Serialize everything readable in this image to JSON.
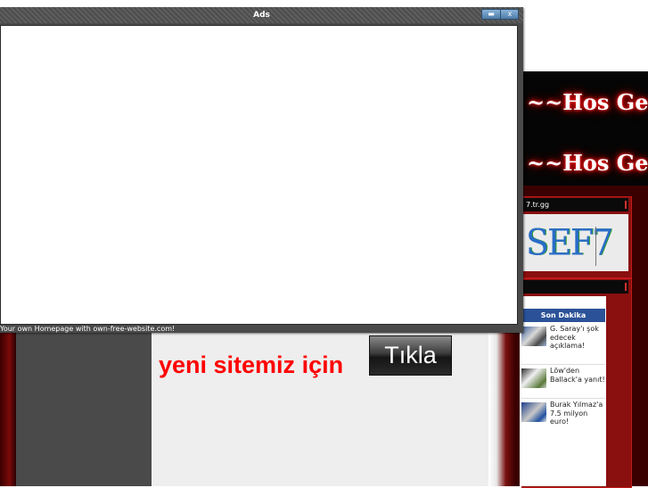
{
  "ads_window": {
    "title": "Ads",
    "minimize_glyph": "▬",
    "close_glyph": "x",
    "footer_link": "Your own Homepage with own-free-website.com!"
  },
  "site": {
    "banner_text_1": "~~Hos Ge",
    "banner_text_2": "~~Hos Ge",
    "counter_box_header": "7.tr.gg",
    "counter_value": "SEF7",
    "main_text": "yeni sitemiz için",
    "tikla_label": "Tıkla",
    "news": {
      "title": "Son Dakika",
      "items": [
        {
          "text": "G. Saray'ı şok edecek açıklama!"
        },
        {
          "text": "Löw'den Ballack'a yanıt!"
        },
        {
          "text": "Burak Yılmaz'a 7.5 milyon euro!"
        }
      ]
    }
  },
  "colors": {
    "accent_red": "#ff0000",
    "dark_red": "#8a0f0f",
    "news_header_blue": "#2b5298"
  }
}
